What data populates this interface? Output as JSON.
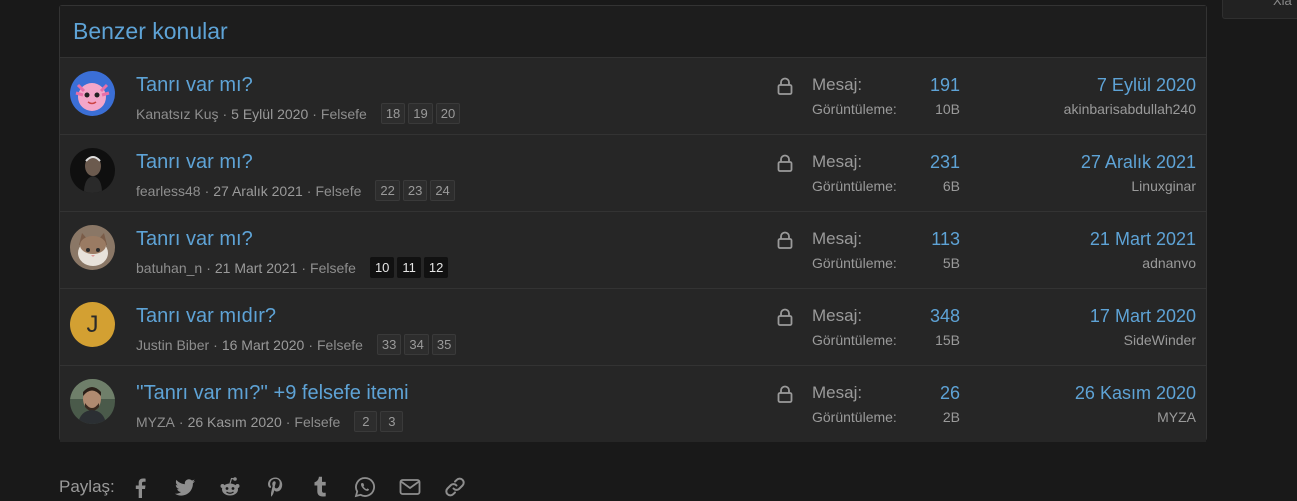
{
  "corner_tab": {
    "text": "Xia"
  },
  "block": {
    "title": "Benzer konular"
  },
  "labels": {
    "messages": "Mesaj:",
    "views": "Görüntüleme:"
  },
  "threads": [
    {
      "title": "Tanrı var mı?",
      "author": "Kanatsız Kuş",
      "date": "5 Eylül 2020",
      "forum": "Felsefe",
      "pages": [
        "18",
        "19",
        "20"
      ],
      "messages": "191",
      "views": "10B",
      "last_date": "7 Eylül 2020",
      "last_user": "akinbarisabdullah240",
      "avatar": "axolotl"
    },
    {
      "title": "Tanrı var mı?",
      "author": "fearless48",
      "date": "27 Aralık 2021",
      "forum": "Felsefe",
      "pages": [
        "22",
        "23",
        "24"
      ],
      "messages": "231",
      "views": "6B",
      "last_date": "27 Aralık 2021",
      "last_user": "Linuxginar",
      "avatar": "dark-person"
    },
    {
      "title": "Tanrı var mı?",
      "author": "batuhan_n",
      "date": "21 Mart 2021",
      "forum": "Felsefe",
      "pages": [
        "10",
        "11",
        "12"
      ],
      "messages": "113",
      "views": "5B",
      "last_date": "21 Mart 2021",
      "last_user": "adnanvo",
      "avatar": "cat"
    },
    {
      "title": "Tanrı var mıdır?",
      "author": "Justin Biber",
      "date": "16 Mart 2020",
      "forum": "Felsefe",
      "pages": [
        "33",
        "34",
        "35"
      ],
      "messages": "348",
      "views": "15B",
      "last_date": "17 Mart 2020",
      "last_user": "SideWinder",
      "avatar": "J"
    },
    {
      "title": "''Tanrı var mı?'' +9 felsefe itemi",
      "author": "MYZA",
      "date": "26 Kasım 2020",
      "forum": "Felsefe",
      "pages": [
        "2",
        "3"
      ],
      "messages": "26",
      "views": "2B",
      "last_date": "26 Kasım 2020",
      "last_user": "MYZA",
      "avatar": "man-photo"
    }
  ],
  "share": {
    "label": "Paylaş:",
    "icons": [
      "facebook-icon",
      "twitter-icon",
      "reddit-icon",
      "pinterest-icon",
      "tumblr-icon",
      "whatsapp-icon",
      "email-icon",
      "link-icon"
    ]
  },
  "colors": {
    "accent": "#5ea3d6",
    "background": "#191919",
    "row": "#262626",
    "avatar_letter_bg": "#d3a032"
  }
}
